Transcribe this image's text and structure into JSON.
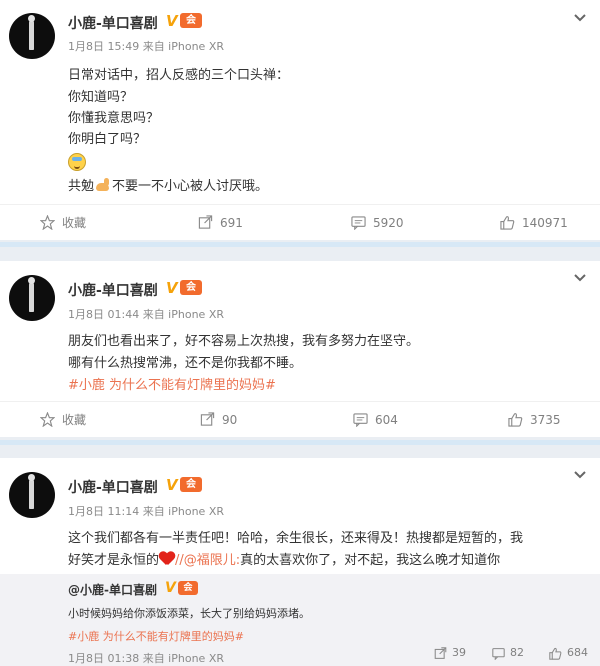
{
  "posts": [
    {
      "author": "小鹿-单口喜剧",
      "verified_mark": "V",
      "member_badge": "会",
      "meta": "1月8日 15:49 来自 iPhone XR",
      "lines": [
        "日常对话中，招人反感的三个口头禅：",
        "你知道吗？",
        "你懂我意思吗？",
        "你明白了吗？"
      ],
      "emoji_icon": "grimace-emoji-icon",
      "last_line_prefix": "共勉",
      "last_line_suffix": "不要一不小心被人讨厌哦。",
      "actions": {
        "favorite": "收藏",
        "repost": "691",
        "comment": "5920",
        "like": "140971"
      }
    },
    {
      "author": "小鹿-单口喜剧",
      "verified_mark": "V",
      "member_badge": "会",
      "meta": "1月8日 01:44 来自 iPhone XR",
      "lines": [
        "朋友们也看出来了，好不容易上次热搜，我有多努力在坚守。",
        "哪有什么热搜常沸，还不是你我都不睡。"
      ],
      "topic": "#小鹿 为什么不能有灯牌里的妈妈#",
      "actions": {
        "favorite": "收藏",
        "repost": "90",
        "comment": "604",
        "like": "3735"
      }
    },
    {
      "author": "小鹿-单口喜剧",
      "verified_mark": "V",
      "member_badge": "会",
      "meta": "1月8日 11:14 来自 iPhone XR",
      "line1": "这个我们都各有一半责任吧！哈哈，余生很长，还来得及！热搜都是短暂的，我",
      "line2_prefix": "好笑才是永恒的",
      "line2_mention": "//@福限儿:",
      "line2_suffix": "真的太喜欢你了，对不起，我这么晚才知道你",
      "repost": {
        "author": "@小鹿-单口喜剧",
        "text": "小时候妈妈给你添饭添菜，长大了别给妈妈添堵。",
        "topic": "#小鹿 为什么不能有灯牌里的妈妈#",
        "meta": "1月8日 01:38 来自 iPhone XR",
        "repost_count": "39",
        "comment_count": "82",
        "like_count": "684"
      }
    }
  ],
  "colors": {
    "link": "#eb7350",
    "verified": "#f5a20a",
    "member": "#f26b2d",
    "separator": "#d7e8f6"
  }
}
